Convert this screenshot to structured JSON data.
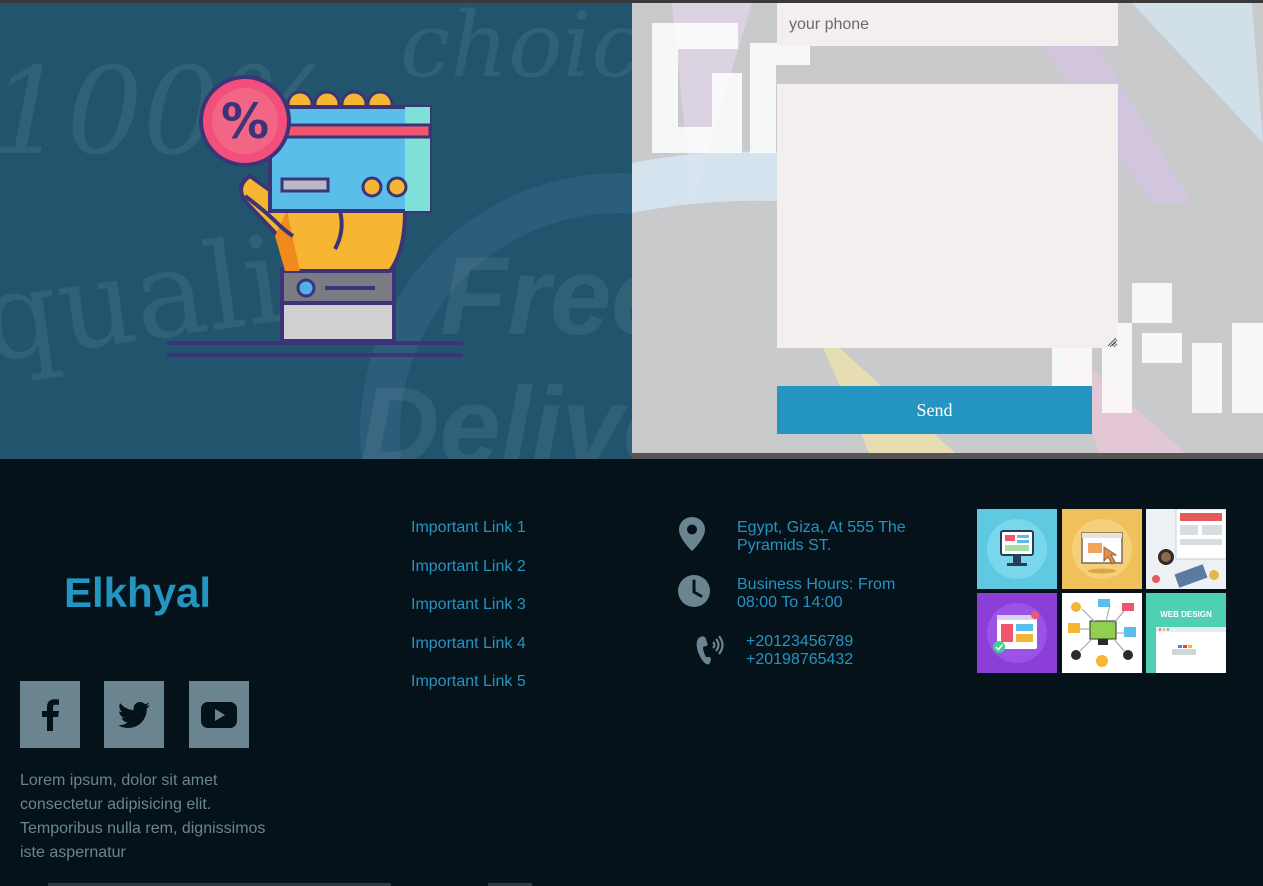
{
  "contact_form": {
    "phone_placeholder": "your phone",
    "message_value": "",
    "send_label": "Send"
  },
  "footer": {
    "brand": "Elkhyal",
    "about": "Lorem ipsum, dolor sit amet consectetur adipisicing elit. Temporibus nulla rem, dignissimos iste aspernatur",
    "social": [
      {
        "icon": "facebook-icon"
      },
      {
        "icon": "twitter-icon"
      },
      {
        "icon": "youtube-icon"
      }
    ],
    "links": [
      "Important Link 1",
      "Important Link 2",
      "Important Link 3",
      "Important Link 4",
      "Important Link 5"
    ],
    "contact": {
      "address": "Egypt, Giza, At 555 The Pyramids ST.",
      "hours": "Business Hours: From 08:00 To 14:00",
      "phone_1": "+20123456789",
      "phone_2": "+20198765432"
    },
    "gallery": [
      {
        "icon": "monitor-illustration"
      },
      {
        "icon": "browser-cursor-illustration"
      },
      {
        "icon": "desk-workspace-photo"
      },
      {
        "icon": "web-layout-illustration"
      },
      {
        "icon": "web-elements-collage"
      },
      {
        "icon": "web-design-banner",
        "caption": "WEB DESIGN"
      }
    ]
  },
  "colors": {
    "accent": "#2494c1",
    "footer_bg": "#06121a",
    "muted": "#6a8590",
    "left_panel": "#22556d",
    "input_bg": "#f3efee"
  }
}
